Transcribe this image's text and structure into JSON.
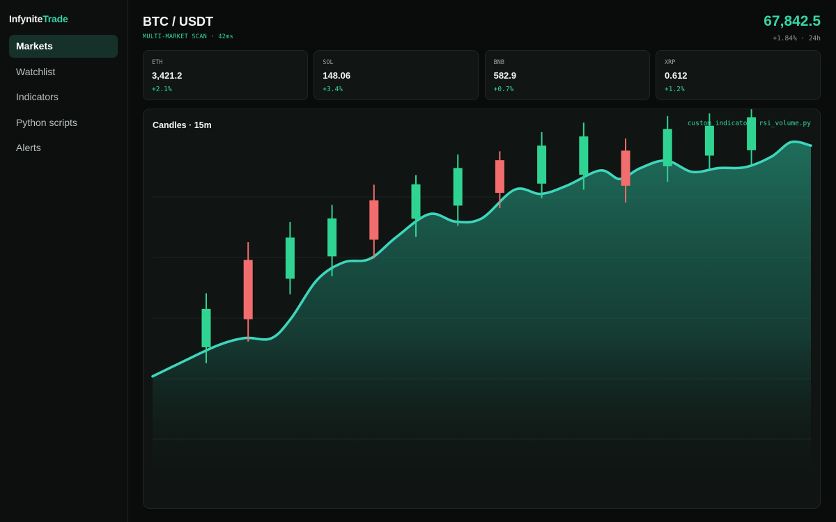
{
  "brand": {
    "part1": "Infynite",
    "part2": "Trade"
  },
  "nav": [
    {
      "label": "Markets",
      "active": true
    },
    {
      "label": "Watchlist",
      "active": false
    },
    {
      "label": "Indicators",
      "active": false
    },
    {
      "label": "Python scripts",
      "active": false
    },
    {
      "label": "Alerts",
      "active": false
    }
  ],
  "header": {
    "pair": "BTC / USDT",
    "subtitle": "MULTI-MARKET SCAN · 42ms",
    "price": "67,842.5",
    "change": "+1.84% · 24h"
  },
  "tickers": [
    {
      "symbol": "ETH",
      "value": "3,421.2",
      "change": "+2.1%"
    },
    {
      "symbol": "SOL",
      "value": "148.06",
      "change": "+3.4%"
    },
    {
      "symbol": "BNB",
      "value": "582.9",
      "change": "+0.7%"
    },
    {
      "symbol": "XRP",
      "value": "0.612",
      "change": "+1.2%"
    }
  ],
  "chart_panel": {
    "title": "Candles · 15m",
    "note": "custom indicator: rsi_volume.py"
  },
  "colors": {
    "accent": "#35d6a6",
    "up": "#2fd493",
    "down": "#f26d6d",
    "line": "#3dd6bd"
  },
  "chart_data": {
    "type": "candlestick",
    "ylim": [
      0,
      100
    ],
    "grid": true,
    "candles": [
      {
        "open": 40.8,
        "close": 51.6,
        "high": 56.0,
        "low": 36.3,
        "dir": "up"
      },
      {
        "open": 65.4,
        "close": 48.7,
        "high": 70.4,
        "low": 42.4,
        "dir": "down"
      },
      {
        "open": 60.1,
        "close": 71.7,
        "high": 76.1,
        "low": 55.7,
        "dir": "up"
      },
      {
        "open": 66.4,
        "close": 77.1,
        "high": 80.9,
        "low": 60.8,
        "dir": "up"
      },
      {
        "open": 71.1,
        "close": 82.2,
        "high": 86.6,
        "low": 65.8,
        "dir": "down"
      },
      {
        "open": 77.0,
        "close": 86.7,
        "high": 89.3,
        "low": 71.9,
        "dir": "up"
      },
      {
        "open": 80.7,
        "close": 91.3,
        "high": 95.1,
        "low": 75.0,
        "dir": "up"
      },
      {
        "open": 93.5,
        "close": 84.3,
        "high": 96.0,
        "low": 80.0,
        "dir": "down"
      },
      {
        "open": 86.9,
        "close": 97.6,
        "high": 101.4,
        "low": 82.8,
        "dir": "up"
      },
      {
        "open": 89.4,
        "close": 100.2,
        "high": 104.1,
        "low": 85.2,
        "dir": "up"
      },
      {
        "open": 96.2,
        "close": 86.3,
        "high": 99.6,
        "low": 81.6,
        "dir": "down"
      },
      {
        "open": 91.8,
        "close": 102.3,
        "high": 105.9,
        "low": 87.4,
        "dir": "up"
      },
      {
        "open": 94.8,
        "close": 103.2,
        "high": 106.7,
        "low": 91.0,
        "dir": "up"
      },
      {
        "open": 96.3,
        "close": 105.6,
        "high": 108.4,
        "low": 92.0,
        "dir": "up"
      }
    ],
    "line": [
      [
        0.0,
        32.6
      ],
      [
        0.05,
        37.1
      ],
      [
        0.1,
        41.4
      ],
      [
        0.14,
        43.4
      ],
      [
        0.18,
        43.3
      ],
      [
        0.21,
        48.8
      ],
      [
        0.25,
        59.8
      ],
      [
        0.29,
        64.7
      ],
      [
        0.33,
        65.7
      ],
      [
        0.37,
        71.8
      ],
      [
        0.42,
        78.3
      ],
      [
        0.46,
        76.2
      ],
      [
        0.5,
        77.1
      ],
      [
        0.55,
        85.2
      ],
      [
        0.59,
        84.0
      ],
      [
        0.63,
        86.4
      ],
      [
        0.68,
        90.6
      ],
      [
        0.71,
        88.2
      ],
      [
        0.74,
        91.2
      ],
      [
        0.78,
        93.4
      ],
      [
        0.82,
        90.2
      ],
      [
        0.86,
        91.3
      ],
      [
        0.9,
        91.5
      ],
      [
        0.94,
        94.5
      ],
      [
        0.97,
        98.6
      ],
      [
        1.0,
        97.6
      ]
    ]
  }
}
